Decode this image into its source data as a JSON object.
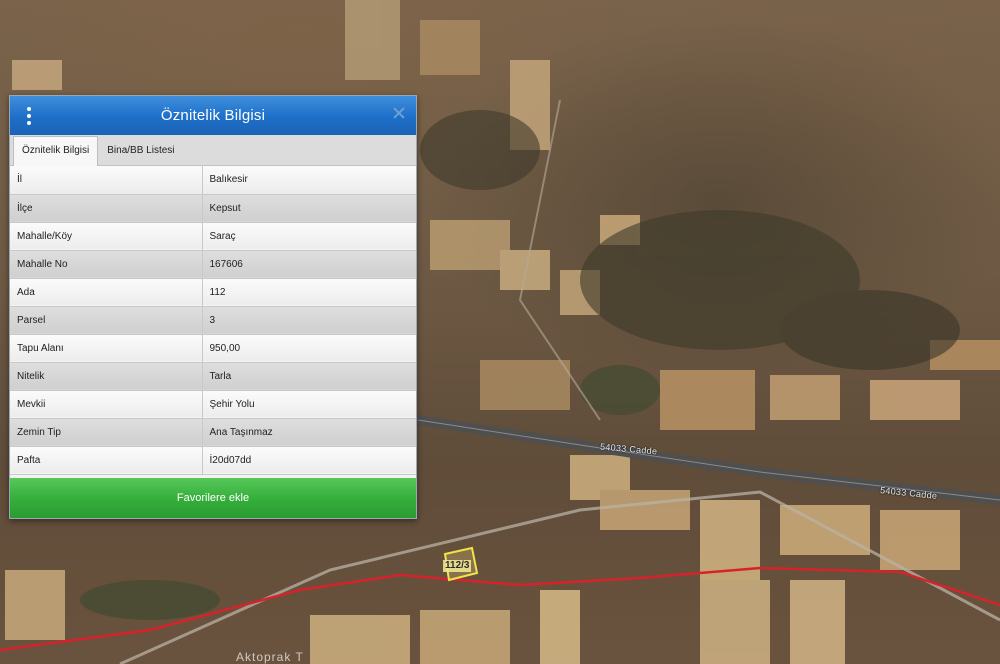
{
  "panel": {
    "title": "Öznitelik Bilgisi",
    "menu_icon": "vertical-dots-icon",
    "close_icon": "close-icon",
    "tabs": [
      {
        "label": "Öznitelik Bilgisi",
        "active": true
      },
      {
        "label": "Bina/BB Listesi",
        "active": false
      }
    ],
    "rows": [
      {
        "key": "İl",
        "value": "Balıkesir"
      },
      {
        "key": "İlçe",
        "value": "Kepsut"
      },
      {
        "key": "Mahalle/Köy",
        "value": "Saraç"
      },
      {
        "key": "Mahalle No",
        "value": "167606"
      },
      {
        "key": "Ada",
        "value": "112"
      },
      {
        "key": "Parsel",
        "value": "3"
      },
      {
        "key": "Tapu Alanı",
        "value": "950,00"
      },
      {
        "key": "Nitelik",
        "value": "Tarla"
      },
      {
        "key": "Mevkii",
        "value": "Şehir Yolu"
      },
      {
        "key": "Zemin Tip",
        "value": "Ana Taşınmaz"
      },
      {
        "key": "Pafta",
        "value": "İ20d07dd"
      }
    ],
    "favorite_button": "Favorilere ekle"
  },
  "map": {
    "road_labels": [
      "54033 Cadde",
      "54033 Cadde"
    ],
    "parcel_label": "112/3",
    "place_label": "Aktoprak T"
  },
  "colors": {
    "header_blue": "#1e6fc9",
    "button_green": "#34ad3a",
    "parcel_outline": "#f2e34a",
    "boundary_red": "#d8222b"
  }
}
